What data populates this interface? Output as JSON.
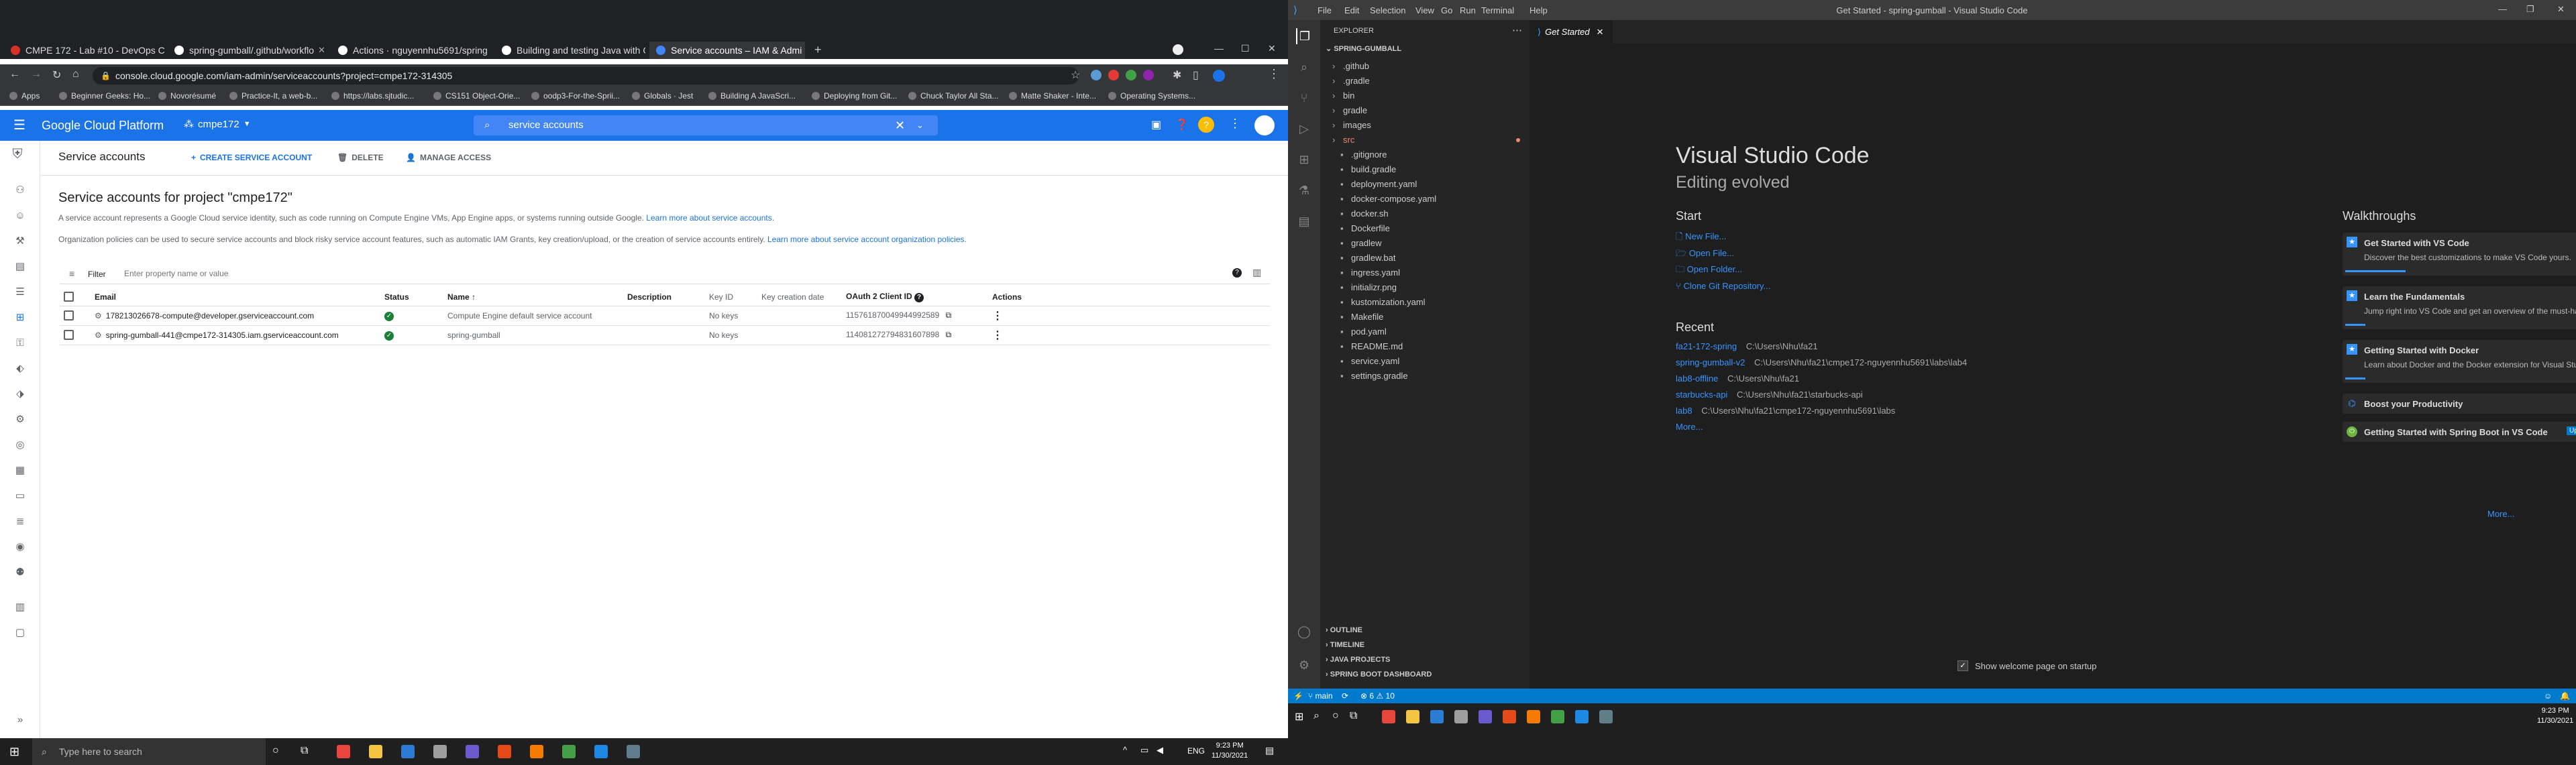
{
  "browser": {
    "tabs": [
      {
        "label": "CMPE 172 - Lab #10 - DevOps C"
      },
      {
        "label": "spring-gumball/.github/workflo"
      },
      {
        "label": "Actions · nguyennhu5691/spring"
      },
      {
        "label": "Building and testing Java with G"
      },
      {
        "label": "Service accounts – IAM & Admi"
      }
    ],
    "url": "console.cloud.google.com/iam-admin/serviceaccounts?project=cmpe172-314305",
    "bookmarks": [
      "Apps",
      "Beginner Geeks: Ho...",
      "Novorésumé",
      "Practice-It, a web-b...",
      "https://labs.sjtudic...",
      "CS151 Object-Orie...",
      "oodp3-For-the-Sprii...",
      "Globals · Jest",
      "Building A JavaScri...",
      "Deploying from Git...",
      "Chuck Taylor All Sta...",
      "Matte Shaker - Inte...",
      "Operating Systems..."
    ]
  },
  "gcp": {
    "brand": "Google Cloud Platform",
    "project": "cmpe172",
    "search_value": "service accounts",
    "page_title": "Service accounts",
    "actions": {
      "create": "CREATE SERVICE ACCOUNT",
      "delete": "DELETE",
      "manage": "MANAGE ACCESS"
    },
    "heading": "Service accounts for project \"cmpe172\"",
    "desc1": "A service account represents a Google Cloud service identity, such as code running on Compute Engine VMs, App Engine apps, or systems running outside Google.",
    "desc1_link": "Learn more about service accounts.",
    "desc2": "Organization policies can be used to secure service accounts and block risky service account features, such as automatic IAM Grants, key creation/upload, or the creation of service accounts entirely.",
    "desc2_link": "Learn more about service account organization policies.",
    "filter_label": "Filter",
    "filter_placeholder": "Enter property name or value",
    "columns": [
      "Email",
      "Status",
      "Name",
      "Description",
      "Key ID",
      "Key creation date",
      "OAuth 2 Client ID",
      "Actions"
    ],
    "rows": [
      {
        "email": "178213026678-compute@developer.gserviceaccount.com",
        "name": "Compute Engine default service account",
        "description": "",
        "key_id": "No keys",
        "key_date": "",
        "oauth": "115761870049944992589"
      },
      {
        "email": "spring-gumball-441@cmpe172-314305.iam.gserviceaccount.com",
        "name": "spring-gumball",
        "description": "",
        "key_id": "No keys",
        "key_date": "",
        "oauth": "114081272794831607898"
      }
    ]
  },
  "taskbar_left": {
    "search_placeholder": "Type here to search",
    "lang": "ENG",
    "time": "9:23 PM",
    "date": "11/30/2021"
  },
  "vscode": {
    "menu": [
      "File",
      "Edit",
      "Selection",
      "View",
      "Go",
      "Run",
      "Terminal",
      "Help"
    ],
    "title": "Get Started - spring-gumball - Visual Studio Code",
    "explorer_label": "EXPLORER",
    "root": "SPRING-GUMBALL",
    "files": [
      {
        "name": ".github",
        "kind": "folder"
      },
      {
        "name": ".gradle",
        "kind": "folder"
      },
      {
        "name": "bin",
        "kind": "folder"
      },
      {
        "name": "gradle",
        "kind": "folder"
      },
      {
        "name": "images",
        "kind": "folder"
      },
      {
        "name": "src",
        "kind": "folder-err"
      },
      {
        "name": ".gitignore",
        "kind": "file"
      },
      {
        "name": "build.gradle",
        "kind": "file"
      },
      {
        "name": "deployment.yaml",
        "kind": "file"
      },
      {
        "name": "docker-compose.yaml",
        "kind": "file"
      },
      {
        "name": "docker.sh",
        "kind": "file"
      },
      {
        "name": "Dockerfile",
        "kind": "file"
      },
      {
        "name": "gradlew",
        "kind": "file"
      },
      {
        "name": "gradlew.bat",
        "kind": "file"
      },
      {
        "name": "ingress.yaml",
        "kind": "file"
      },
      {
        "name": "initializr.png",
        "kind": "file"
      },
      {
        "name": "kustomization.yaml",
        "kind": "file"
      },
      {
        "name": "Makefile",
        "kind": "file"
      },
      {
        "name": "pod.yaml",
        "kind": "file"
      },
      {
        "name": "README.md",
        "kind": "file"
      },
      {
        "name": "service.yaml",
        "kind": "file"
      },
      {
        "name": "settings.gradle",
        "kind": "file"
      }
    ],
    "panels": [
      "OUTLINE",
      "TIMELINE",
      "JAVA PROJECTS",
      "SPRING BOOT DASHBOARD"
    ],
    "editor_tab": "Get Started",
    "welcome_title": "Visual Studio Code",
    "welcome_subtitle": "Editing evolved",
    "start_label": "Start",
    "start_items": [
      "New File...",
      "Open File...",
      "Open Folder...",
      "Clone Git Repository..."
    ],
    "recent_label": "Recent",
    "recent": [
      {
        "name": "fa21-172-spring",
        "path": "C:\\Users\\Nhu\\fa21"
      },
      {
        "name": "spring-gumball-v2",
        "path": "C:\\Users\\Nhu\\fa21\\cmpe172-nguyennhu5691\\labs\\lab4"
      },
      {
        "name": "lab8-offline",
        "path": "C:\\Users\\Nhu\\fa21"
      },
      {
        "name": "starbucks-api",
        "path": "C:\\Users\\Nhu\\fa21\\starbucks-api"
      },
      {
        "name": "lab8",
        "path": "C:\\Users\\Nhu\\fa21\\cmpe172-nguyennhu5691\\labs"
      }
    ],
    "recent_more": "More...",
    "walkthroughs_label": "Walkthroughs",
    "walkthroughs": [
      {
        "title": "Get Started with VS Code",
        "desc": "Discover the best customizations to make VS Code yours."
      },
      {
        "title": "Learn the Fundamentals",
        "desc": "Jump right into VS Code and get an overview of the must-have features."
      },
      {
        "title": "Getting Started with Docker",
        "desc": "Learn about Docker and the Docker extension for Visual Studio Code"
      },
      {
        "title": "Boost your Productivity",
        "desc": ""
      },
      {
        "title": "Getting Started with Spring Boot in VS Code",
        "desc": "",
        "badge": "Updated"
      }
    ],
    "walk_more": "More...",
    "show_welcome": "Show welcome page on startup",
    "status": {
      "branch": "main",
      "problems": "6",
      "warnings": "10"
    },
    "time": "9:23 PM",
    "date": "11/30/2021"
  },
  "colors": {
    "gcp_blue": "#1a73e8",
    "vscode_status": "#007acc",
    "vscode_bg": "#1e1e1e"
  }
}
